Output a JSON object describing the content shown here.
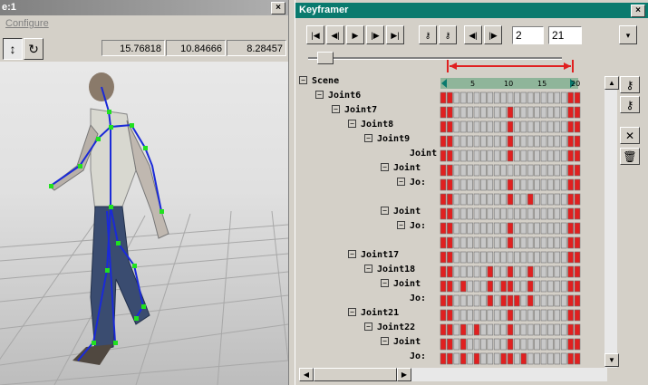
{
  "viewport": {
    "title": "e:1",
    "menu_configure": "Configure",
    "coords": [
      "15.76818",
      "10.84666",
      "8.28457"
    ]
  },
  "keyframer": {
    "title": "Keyframer",
    "frame_start": "2",
    "frame_end": "21",
    "scale_labels": [
      "5",
      "10",
      "15",
      "20"
    ],
    "tree": [
      {
        "label": "Scene",
        "indent": 0,
        "expander": "−"
      },
      {
        "label": "Joint6",
        "indent": 1,
        "expander": "−"
      },
      {
        "label": "Joint7",
        "indent": 2,
        "expander": "−"
      },
      {
        "label": "Joint8",
        "indent": 3,
        "expander": "−"
      },
      {
        "label": "Joint9",
        "indent": 4,
        "expander": "−"
      },
      {
        "label": "Joint",
        "indent": 6,
        "expander": ""
      },
      {
        "label": "Joint",
        "indent": 5,
        "expander": "−"
      },
      {
        "label": "Jo:",
        "indent": 6,
        "expander": "−"
      },
      {
        "label": "",
        "indent": 0,
        "expander": ""
      },
      {
        "label": "Joint",
        "indent": 5,
        "expander": "−"
      },
      {
        "label": "Jo:",
        "indent": 6,
        "expander": "−"
      },
      {
        "label": "",
        "indent": 0,
        "expander": ""
      },
      {
        "label": "Joint17",
        "indent": 3,
        "expander": "−"
      },
      {
        "label": "Joint18",
        "indent": 4,
        "expander": "−"
      },
      {
        "label": "Joint",
        "indent": 5,
        "expander": "−"
      },
      {
        "label": "Jo:",
        "indent": 6,
        "expander": ""
      },
      {
        "label": "Joint21",
        "indent": 3,
        "expander": "−"
      },
      {
        "label": "Joint22",
        "indent": 4,
        "expander": "−"
      },
      {
        "label": "Joint",
        "indent": 5,
        "expander": "−"
      },
      {
        "label": "Jo:",
        "indent": 6,
        "expander": ""
      }
    ],
    "key_rows": [
      [
        1,
        1,
        0,
        0,
        0,
        0,
        0,
        0,
        0,
        0,
        0,
        0,
        0,
        0,
        0,
        0,
        0,
        0,
        0,
        1,
        1
      ],
      [
        1,
        1,
        0,
        0,
        0,
        0,
        0,
        0,
        0,
        0,
        1,
        0,
        0,
        0,
        0,
        0,
        0,
        0,
        0,
        1,
        1
      ],
      [
        1,
        1,
        0,
        0,
        0,
        0,
        0,
        0,
        0,
        0,
        1,
        0,
        0,
        0,
        0,
        0,
        0,
        0,
        0,
        1,
        1
      ],
      [
        1,
        1,
        0,
        0,
        0,
        0,
        0,
        0,
        0,
        0,
        1,
        0,
        0,
        0,
        0,
        0,
        0,
        0,
        0,
        1,
        1
      ],
      [
        1,
        1,
        0,
        0,
        0,
        0,
        0,
        0,
        0,
        0,
        1,
        0,
        0,
        0,
        0,
        0,
        0,
        0,
        0,
        1,
        1
      ],
      [
        1,
        1,
        0,
        0,
        0,
        0,
        0,
        0,
        0,
        0,
        0,
        0,
        0,
        0,
        0,
        0,
        0,
        0,
        0,
        1,
        1
      ],
      [
        1,
        1,
        0,
        0,
        0,
        0,
        0,
        0,
        0,
        0,
        1,
        0,
        0,
        0,
        0,
        0,
        0,
        0,
        0,
        1,
        1
      ],
      [
        1,
        1,
        0,
        0,
        0,
        0,
        0,
        0,
        0,
        0,
        1,
        0,
        0,
        1,
        0,
        0,
        0,
        0,
        0,
        1,
        1
      ],
      [
        1,
        1,
        0,
        0,
        0,
        0,
        0,
        0,
        0,
        0,
        0,
        0,
        0,
        0,
        0,
        0,
        0,
        0,
        0,
        1,
        1
      ],
      [
        1,
        1,
        0,
        0,
        0,
        0,
        0,
        0,
        0,
        0,
        1,
        0,
        0,
        0,
        0,
        0,
        0,
        0,
        0,
        1,
        1
      ],
      [
        1,
        1,
        0,
        0,
        0,
        0,
        0,
        0,
        0,
        0,
        1,
        0,
        0,
        0,
        0,
        0,
        0,
        0,
        0,
        1,
        1
      ],
      [
        1,
        1,
        0,
        0,
        0,
        0,
        0,
        0,
        0,
        0,
        0,
        0,
        0,
        0,
        0,
        0,
        0,
        0,
        0,
        1,
        1
      ],
      [
        1,
        1,
        0,
        0,
        0,
        0,
        0,
        1,
        0,
        0,
        1,
        0,
        0,
        1,
        0,
        0,
        0,
        0,
        0,
        1,
        1
      ],
      [
        1,
        1,
        0,
        1,
        0,
        0,
        0,
        1,
        0,
        1,
        1,
        0,
        0,
        1,
        0,
        0,
        0,
        0,
        0,
        1,
        1
      ],
      [
        1,
        1,
        0,
        0,
        0,
        0,
        0,
        1,
        0,
        1,
        1,
        1,
        0,
        1,
        0,
        0,
        0,
        0,
        0,
        1,
        1
      ],
      [
        1,
        1,
        0,
        0,
        0,
        0,
        0,
        0,
        0,
        0,
        1,
        0,
        0,
        0,
        0,
        0,
        0,
        0,
        0,
        1,
        1
      ],
      [
        1,
        1,
        0,
        1,
        0,
        1,
        0,
        0,
        0,
        0,
        1,
        0,
        0,
        0,
        0,
        0,
        0,
        0,
        0,
        1,
        1
      ],
      [
        1,
        1,
        0,
        1,
        0,
        0,
        0,
        0,
        0,
        0,
        1,
        0,
        0,
        0,
        0,
        0,
        0,
        0,
        0,
        1,
        1
      ],
      [
        1,
        1,
        0,
        1,
        0,
        1,
        0,
        0,
        0,
        1,
        1,
        0,
        1,
        0,
        0,
        0,
        0,
        0,
        0,
        1,
        1
      ],
      [
        1,
        1,
        0,
        0,
        0,
        0,
        0,
        0,
        0,
        0,
        1,
        0,
        0,
        0,
        0,
        0,
        0,
        0,
        0,
        1,
        1
      ]
    ]
  },
  "colors": {
    "keyframer_title": "#0a7a6e",
    "key_on": "#e02020",
    "key_off": "#c8c8c8",
    "range_arrow": "#e02020",
    "bone": "#1a2ad8",
    "joint": "#20e020"
  }
}
